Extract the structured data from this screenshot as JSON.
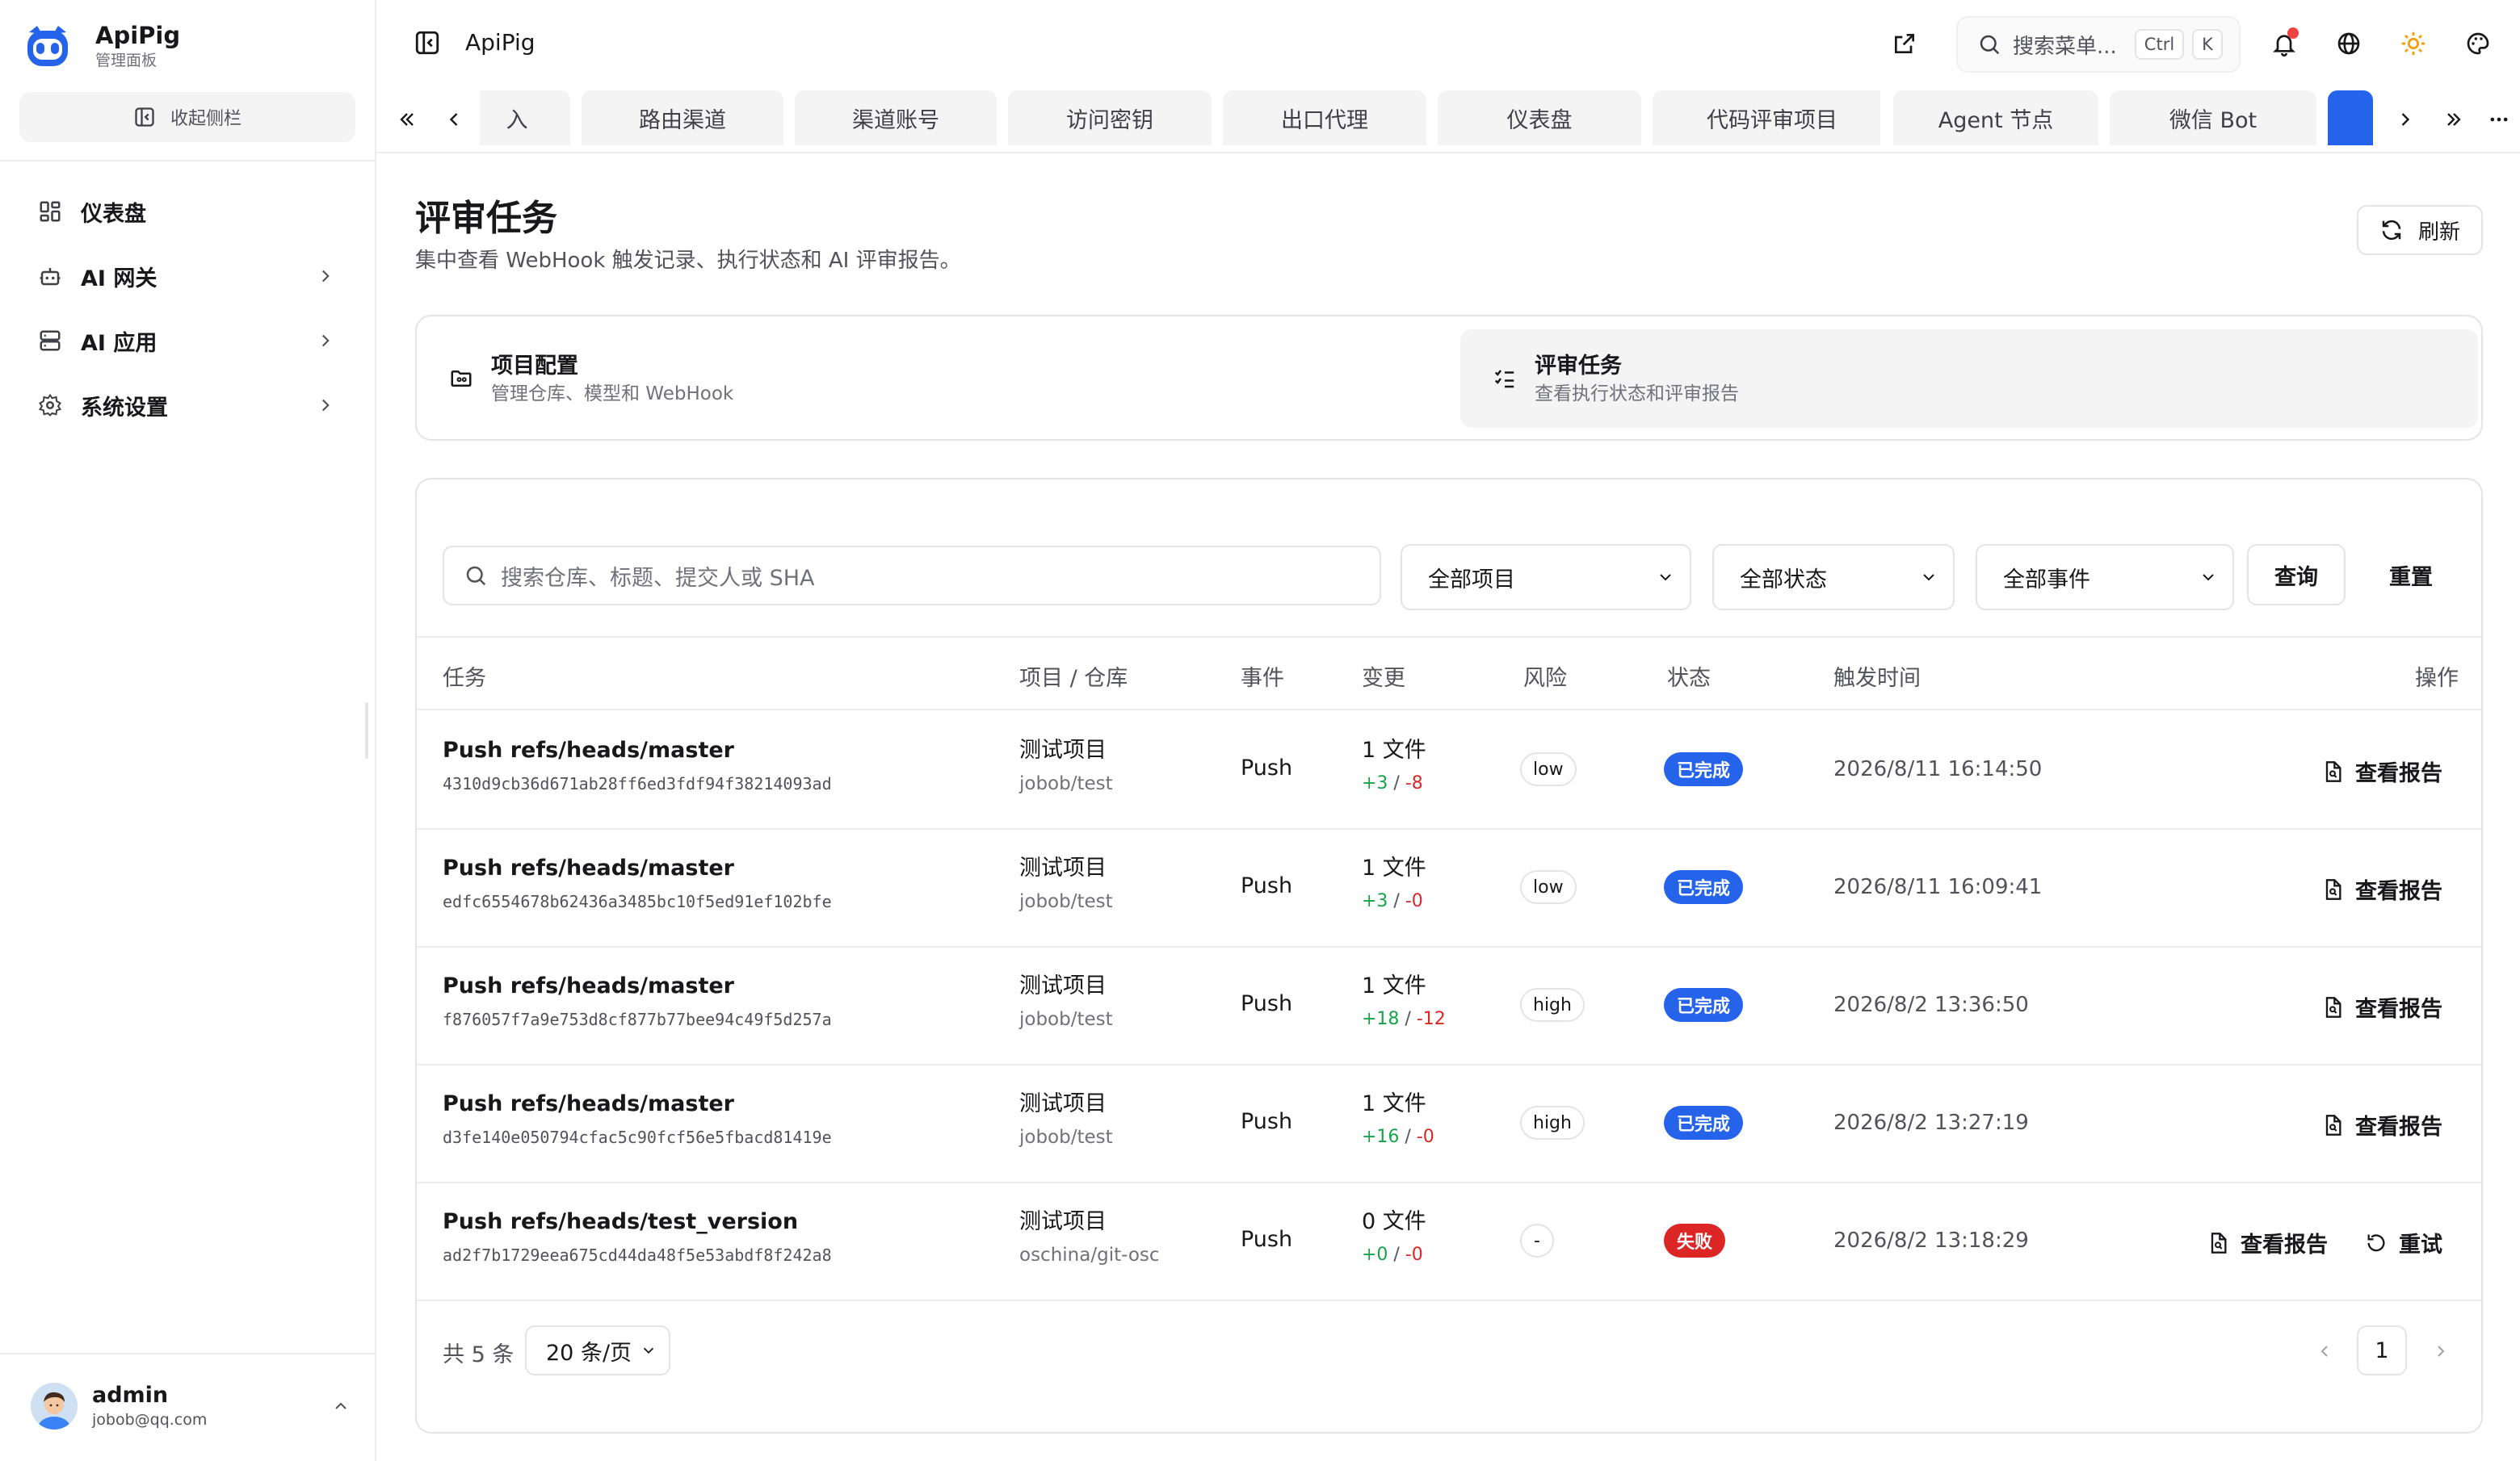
{
  "sidebar": {
    "brand_title": "ApiPig",
    "brand_subtitle": "管理面板",
    "collapse_label": "收起侧栏",
    "items": [
      {
        "label": "仪表盘",
        "icon": "dashboard-icon"
      },
      {
        "label": "AI 网关",
        "icon": "bot-icon"
      },
      {
        "label": "AI 应用",
        "icon": "server-icon"
      },
      {
        "label": "系统设置",
        "icon": "gear-icon"
      }
    ],
    "user": {
      "name": "admin",
      "email": "jobob@qq.com"
    }
  },
  "topbar": {
    "breadcrumb": "ApiPig",
    "search_placeholder": "搜索菜单...",
    "shortcut_ctrl": "Ctrl",
    "shortcut_key": "K"
  },
  "tabs": [
    {
      "label": "入"
    },
    {
      "label": "路由渠道"
    },
    {
      "label": "渠道账号"
    },
    {
      "label": "访问密钥"
    },
    {
      "label": "出口代理"
    },
    {
      "label": "仪表盘"
    },
    {
      "label": "代码评审项目"
    },
    {
      "label": "Agent 节点"
    },
    {
      "label": "微信 Bot"
    },
    {
      "label": ""
    }
  ],
  "page": {
    "title": "评审任务",
    "description": "集中查看 WebHook 触发记录、执行状态和 AI 评审报告。",
    "refresh_label": "刷新"
  },
  "segments": [
    {
      "title": "项目配置",
      "subtitle": "管理仓库、模型和 WebHook",
      "active": false
    },
    {
      "title": "评审任务",
      "subtitle": "查看执行状态和评审报告",
      "active": true
    }
  ],
  "filters": {
    "search_placeholder": "搜索仓库、标题、提交人或 SHA",
    "project": "全部项目",
    "status": "全部状态",
    "event": "全部事件",
    "query_label": "查询",
    "reset_label": "重置"
  },
  "table": {
    "headers": {
      "task": "任务",
      "project": "项目 / 仓库",
      "event": "事件",
      "change": "变更",
      "risk": "风险",
      "status": "状态",
      "time": "触发时间",
      "action": "操作"
    },
    "rows": [
      {
        "title": "Push refs/heads/master",
        "sha": "4310d9cb36d671ab28ff6ed3fdf94f38214093ad",
        "project": "测试项目",
        "repo": "jobob/test",
        "event": "Push",
        "files": "1 文件",
        "add": "+3",
        "del": "-8",
        "risk": "low",
        "status": "已完成",
        "status_type": "done",
        "time": "2026/8/11 16:14:50",
        "report": "查看报告",
        "retry": ""
      },
      {
        "title": "Push refs/heads/master",
        "sha": "edfc6554678b62436a3485bc10f5ed91ef102bfe",
        "project": "测试项目",
        "repo": "jobob/test",
        "event": "Push",
        "files": "1 文件",
        "add": "+3",
        "del": "-0",
        "risk": "low",
        "status": "已完成",
        "status_type": "done",
        "time": "2026/8/11 16:09:41",
        "report": "查看报告",
        "retry": ""
      },
      {
        "title": "Push refs/heads/master",
        "sha": "f876057f7a9e753d8cf877b77bee94c49f5d257a",
        "project": "测试项目",
        "repo": "jobob/test",
        "event": "Push",
        "files": "1 文件",
        "add": "+18",
        "del": "-12",
        "risk": "high",
        "status": "已完成",
        "status_type": "done",
        "time": "2026/8/2 13:36:50",
        "report": "查看报告",
        "retry": ""
      },
      {
        "title": "Push refs/heads/master",
        "sha": "d3fe140e050794cfac5c90fcf56e5fbacd81419e",
        "project": "测试项目",
        "repo": "jobob/test",
        "event": "Push",
        "files": "1 文件",
        "add": "+16",
        "del": "-0",
        "risk": "high",
        "status": "已完成",
        "status_type": "done",
        "time": "2026/8/2 13:27:19",
        "report": "查看报告",
        "retry": ""
      },
      {
        "title": "Push refs/heads/test_version",
        "sha": "ad2f7b1729eea675cd44da48f5e53abdf8f242a8",
        "project": "测试项目",
        "repo": "oschina/git-osc",
        "event": "Push",
        "files": "0 文件",
        "add": "+0",
        "del": "-0",
        "risk": "-",
        "status": "失败",
        "status_type": "fail",
        "time": "2026/8/2 13:18:29",
        "report": "查看报告",
        "retry": "重试"
      }
    ]
  },
  "pagination": {
    "total": "共 5 条",
    "page_size": "20 条/页",
    "current": "1"
  },
  "colors": {
    "accent": "#2563eb",
    "danger": "#dc2626",
    "success": "#16a34a"
  }
}
